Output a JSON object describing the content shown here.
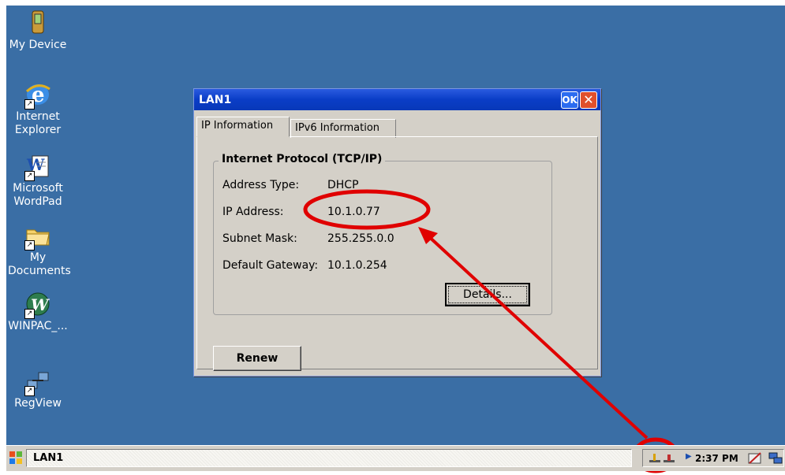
{
  "desktop": {
    "icons": [
      {
        "label": "My Device"
      },
      {
        "label": "Internet\nExplorer"
      },
      {
        "label": "Microsoft\nWordPad"
      },
      {
        "label": "My\nDocuments"
      },
      {
        "label": "WINPAC_..."
      },
      {
        "label": "RegView"
      }
    ]
  },
  "dialog": {
    "title": "LAN1",
    "ok_label": "OK",
    "close_label": "✕",
    "tabs": [
      "IP Information",
      "IPv6 Information"
    ],
    "group_title": "Internet Protocol (TCP/IP)",
    "rows": [
      {
        "label": "Address Type:",
        "value": "DHCP"
      },
      {
        "label": "IP Address:",
        "value": "10.1.0.77"
      },
      {
        "label": "Subnet Mask:",
        "value": "255.255.0.0"
      },
      {
        "label": "Default Gateway:",
        "value": "10.1.0.254"
      }
    ],
    "details_label": "Details...",
    "renew_label": "Renew"
  },
  "taskbar": {
    "task_label": "LAN1",
    "clock": "2:37 PM"
  },
  "colors": {
    "desktop": "#3a6ea5",
    "annotation": "#e00000"
  }
}
